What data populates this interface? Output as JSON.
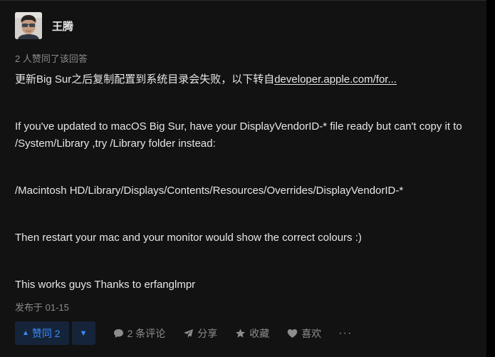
{
  "author": {
    "name": "王腾",
    "avatar_icon": "user-avatar"
  },
  "upvote_summary": "2 人赞同了该回答",
  "answer": {
    "intro_text": "更新Big Sur之后复制配置到系统目录会失败，以下转自",
    "link_text": "developer.apple.com/for...",
    "para1_line1": "If you've updated to macOS Big Sur, have your DisplayVendorID-* file ready but can't copy it to",
    "para1_line2": "/System/Library ,try /Library folder instead:",
    "path": "/Macintosh HD/Library/Displays/Contents/Resources/Overrides/DisplayVendorID-*",
    "para3": "Then restart your mac and your monitor would show the correct colours :)",
    "para4": "This works guys Thanks to erfanglmpr"
  },
  "publish_time": "发布于 01-15",
  "actions": {
    "upvote_label": "赞同 2",
    "upvote_icon": "triangle-up-icon",
    "downvote_icon": "triangle-down-icon",
    "comment_label": "2 条评论",
    "share_label": "分享",
    "collect_label": "收藏",
    "like_label": "喜欢",
    "more_label": "···"
  },
  "colors": {
    "background": "#121212",
    "text": "#e6e6e6",
    "muted": "#8a8a8a",
    "accent": "#3a8dff",
    "vote_bg": "#16243a"
  }
}
